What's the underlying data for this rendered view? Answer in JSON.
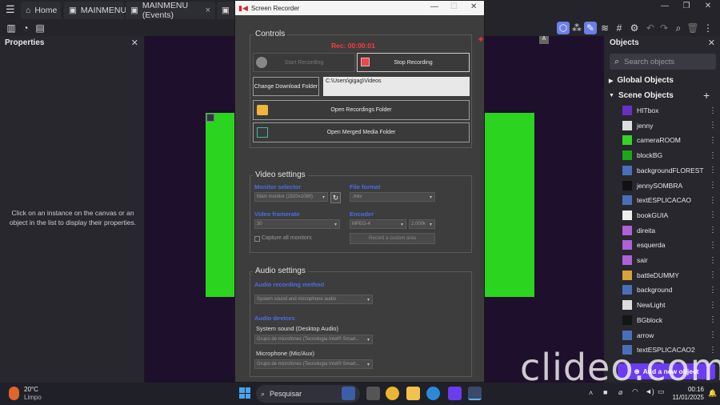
{
  "tabs": [
    {
      "label": "Home",
      "icon": "home-icon"
    },
    {
      "label": "MAINMENU",
      "icon": "scene-icon"
    },
    {
      "label": "MAINMENU (Events)",
      "icon": "events-icon"
    },
    {
      "label": "",
      "icon": "scene-icon"
    }
  ],
  "properties_panel": {
    "title": "Properties",
    "hint": "Click on an instance on the canvas or an object in the list to display their properties."
  },
  "objects_panel": {
    "title": "Objects",
    "search_placeholder": "Search objects",
    "global_objects": "Global Objects",
    "scene_objects": "Scene Objects",
    "add_button": "Add a new object",
    "items": [
      {
        "name": "HITbox",
        "color": "#6a2fc2"
      },
      {
        "name": "jenny",
        "color": "#dddddd"
      },
      {
        "name": "cameraROOM",
        "color": "#34d326"
      },
      {
        "name": "blockBG",
        "color": "#1aa81a"
      },
      {
        "name": "backgroundFLOREST",
        "color": "#4a6fb8"
      },
      {
        "name": "jennySOMBRA",
        "color": "#111111"
      },
      {
        "name": "textESPLICACAO",
        "color": "#4a6fb8"
      },
      {
        "name": "bookGUIA",
        "color": "#eeeeee"
      },
      {
        "name": "direita",
        "color": "#b060d8"
      },
      {
        "name": "esquerda",
        "color": "#b060d8"
      },
      {
        "name": "sair",
        "color": "#b060d8"
      },
      {
        "name": "battleDUMMY",
        "color": "#d8a23a"
      },
      {
        "name": "background",
        "color": "#4a6fb8"
      },
      {
        "name": "NewLight",
        "color": "#dddddd"
      },
      {
        "name": "BGblock",
        "color": "#151515"
      },
      {
        "name": "arrow",
        "color": "#4a6fb8"
      },
      {
        "name": "textESPLICACAO2",
        "color": "#4a6fb8"
      }
    ]
  },
  "recorder": {
    "title": "Screen Recorder",
    "controls_title": "Controls",
    "rec_time": "Rec: 00:00:01",
    "start_label": "Start Recording",
    "stop_label": "Stop Recording",
    "change_folder_label": "Change Download Folder",
    "folder_path": "C:\\Users\\gigag\\Videos",
    "open_recordings_label": "Open Recordings Folder",
    "open_merged_label": "Open Merged Media Folder",
    "video_title": "Video settings",
    "monitor_label": "Monitor selector",
    "monitor_value": "Main monitor (1920x1080)",
    "format_label": "File format",
    "format_value": ".mkv",
    "framerate_label": "Video framerate",
    "framerate_value": "30",
    "encoder_label": "Encoder",
    "encoder_value": "MPEG-4",
    "bitrate_value": "2,000k",
    "capture_all_label": "Capture all monitors",
    "custom_area_label": "Record a custom area",
    "audio_title": "Audio settings",
    "audio_method_label": "Audio recording method",
    "audio_method_value": "System sound and microphone audio",
    "audio_devices_label": "Audio devices",
    "system_sound_label": "System sound (Desktop Audio)",
    "system_sound_value": "Grupo de microfones (Tecnologia Intel® Smart...",
    "mic_label": "Microphone (Mic/Aux)",
    "mic_value": "Grupo de microfones (Tecnologia Intel® Smart..."
  },
  "taskbar": {
    "temp": "20°C",
    "weather": "Limpo",
    "search_label": "Pesquisar",
    "time": "00:16",
    "date": "11/01/2025"
  },
  "watermark": "clideo.com",
  "colors": {
    "accent": "#6b3cf0",
    "canvas_bg": "#1e0f2c",
    "green": "#2bd41f",
    "rec_red": "#ff3b3b",
    "label_blue": "#4a6ee8"
  }
}
